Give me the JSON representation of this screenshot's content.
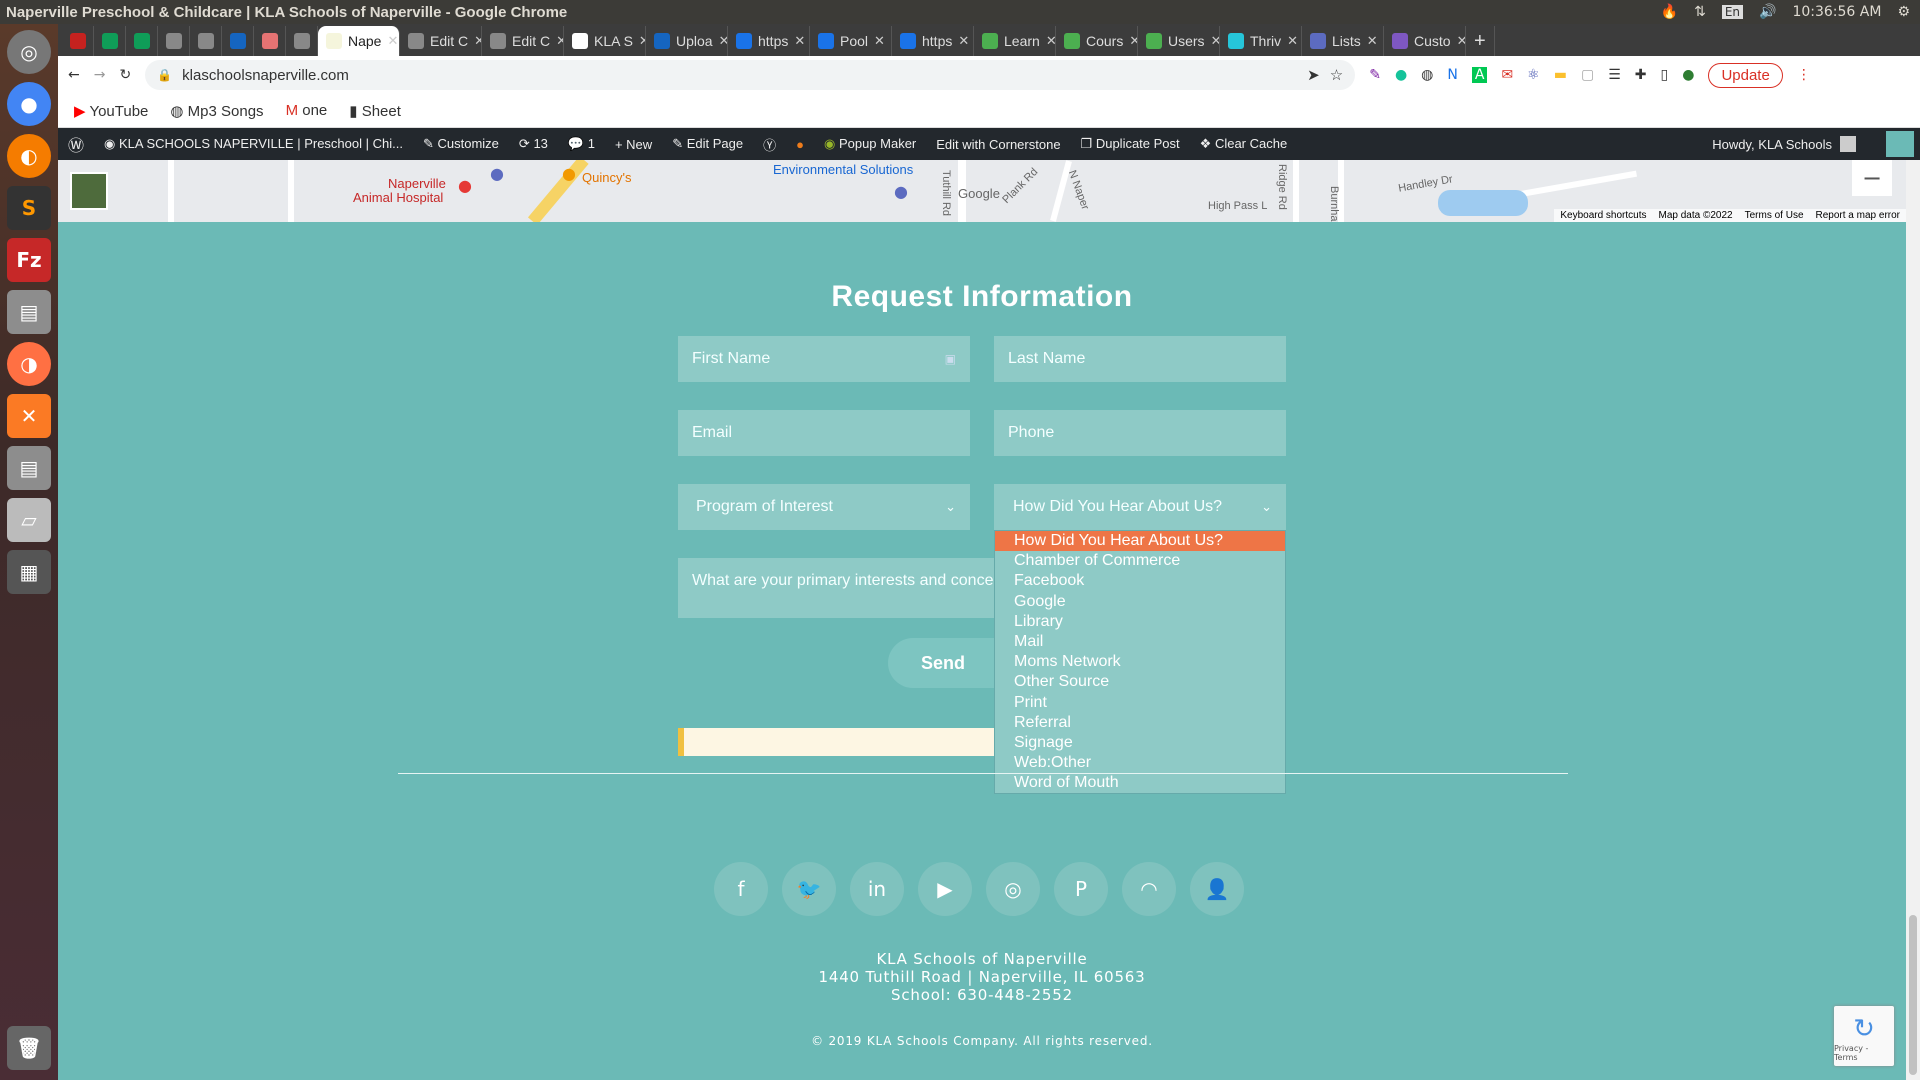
{
  "system": {
    "window_title": "Naperville Preschool & Childcare | KLA Schools of Naperville - Google Chrome",
    "lang": "En",
    "time": "10:36:56 AM"
  },
  "tabs": [
    {
      "label": "",
      "color": "#c5221f"
    },
    {
      "label": "",
      "color": "#0f9d58"
    },
    {
      "label": "",
      "color": "#0f9d58"
    },
    {
      "label": "",
      "color": "#888888"
    },
    {
      "label": "",
      "color": "#888888"
    },
    {
      "label": "",
      "color": "#1565c0"
    },
    {
      "label": "",
      "color": "#e57373"
    },
    {
      "label": "",
      "color": "#888888"
    },
    {
      "label": "Nape",
      "color": "#f5f5dc",
      "active": true
    },
    {
      "label": "Edit C",
      "color": "#888888"
    },
    {
      "label": "Edit C",
      "color": "#888888"
    },
    {
      "label": "KLA S",
      "color": "#ffffff"
    },
    {
      "label": "Uploa",
      "color": "#1565c0"
    },
    {
      "label": "https",
      "color": "#1a73e8"
    },
    {
      "label": "Pool",
      "color": "#1a73e8"
    },
    {
      "label": "https",
      "color": "#1a73e8"
    },
    {
      "label": "Learn",
      "color": "#4caf50"
    },
    {
      "label": "Cours",
      "color": "#4caf50"
    },
    {
      "label": "Users",
      "color": "#4caf50"
    },
    {
      "label": "Thriv",
      "color": "#26c6da"
    },
    {
      "label": "Lists",
      "color": "#5c6bc0"
    },
    {
      "label": "Custo",
      "color": "#7e57c2"
    }
  ],
  "address": {
    "url": "klaschoolsnaperville.com",
    "update_label": "Update"
  },
  "bookmarks": [
    "YouTube",
    "Mp3 Songs",
    "one",
    "Sheet"
  ],
  "wpbar": {
    "site": "KLA SCHOOLS NAPERVILLE | Preschool | Chi...",
    "customize": "Customize",
    "updates": "13",
    "comments": "1",
    "new": "New",
    "edit_page": "Edit Page",
    "popup": "Popup Maker",
    "cornerstone": "Edit with Cornerstone",
    "duplicate": "Duplicate Post",
    "cache": "Clear Cache",
    "howdy": "Howdy, KLA Schools"
  },
  "map": {
    "labels": [
      "Naperville",
      "Animal Hospital",
      "Quincy's",
      "Environmental Solutions",
      "Tuthill Rd",
      "Plank Rd",
      "N Naper",
      "High Pass L",
      "Ridge Rd",
      "Burnha",
      "Handley Dr",
      "Google"
    ],
    "footer": [
      "Keyboard shortcuts",
      "Map data ©2022",
      "Terms of Use",
      "Report a map error"
    ]
  },
  "form": {
    "title": "Request Information",
    "first_name": "First Name",
    "last_name": "Last Name",
    "email": "Email",
    "phone": "Phone",
    "program": "Program of Interest",
    "hear": "How Did You Hear About Us?",
    "message": "What are your primary interests and concer",
    "send": "Send",
    "hear_options": [
      "How Did You Hear About Us?",
      "Chamber of Commerce",
      "Facebook",
      "Google",
      "Library",
      "Mail",
      "Moms Network",
      "Other Source",
      "Print",
      "Referral",
      "Signage",
      "Web:Other",
      "Word of Mouth"
    ]
  },
  "social_icons": [
    "facebook-icon",
    "twitter-icon",
    "linkedin-icon",
    "youtube-icon",
    "instagram-icon",
    "pinterest-icon",
    "rss-icon",
    "user-icon"
  ],
  "footer": {
    "name": "KLA Schools of Naperville",
    "address": "1440 Tuthill Road | Naperville, IL 60563",
    "phone": "School: 630-448-2552",
    "copyright": "© 2019 KLA Schools Company. All rights reserved."
  },
  "recaptcha": "Privacy - Terms"
}
